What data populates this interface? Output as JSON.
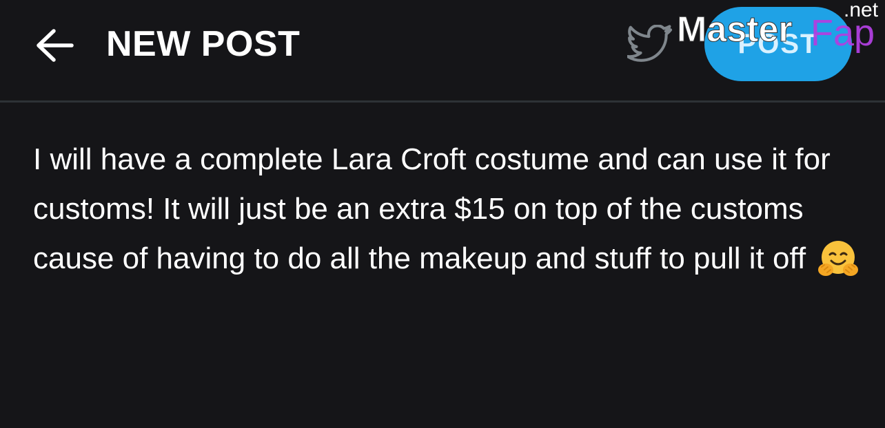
{
  "header": {
    "title": "NEW POST",
    "post_button_label": "POST",
    "back_icon": "arrow-left-icon",
    "share_icon": "twitter-icon"
  },
  "post": {
    "text": "I will have a complete Lara Croft costume and can use it for customs! It will just be an extra $15 on top of the customs cause of having to do all the makeup and stuff to pull it off",
    "emoji": "hugging-face-emoji"
  },
  "watermark": {
    "brand_part1": "Master",
    "brand_part2": "Fap",
    "tld": ".net"
  },
  "colors": {
    "background": "#151518",
    "accent": "#1fa2e6",
    "divider": "#2e3236"
  }
}
